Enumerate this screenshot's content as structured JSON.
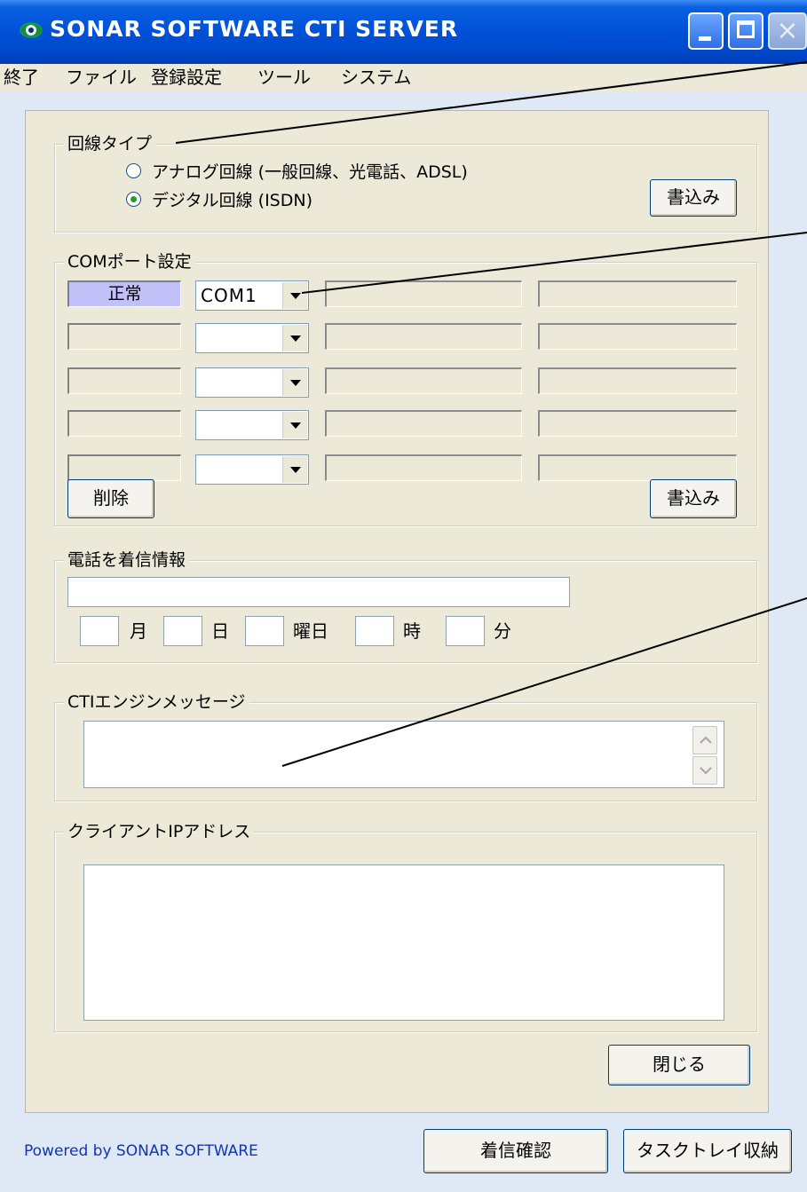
{
  "window": {
    "title": "SONAR SOFTWARE CTI SERVER",
    "close_glyph": "×",
    "icon": "app-eye-icon"
  },
  "menu": [
    {
      "label": "終了"
    },
    {
      "label": "ファイル"
    },
    {
      "label": "登録設定"
    },
    {
      "label": "ツール"
    },
    {
      "label": "システム"
    }
  ],
  "line_type": {
    "group_label": "回線タイプ",
    "options": [
      {
        "label": "アナログ回線 (一般回線、光電話、ADSL)",
        "checked": false
      },
      {
        "label": "デジタル回線 (ISDN)",
        "checked": true
      }
    ],
    "write_button": "書込み"
  },
  "com_ports": {
    "group_label": "COMポート設定",
    "rows": [
      {
        "status": "正常",
        "active": true,
        "port": "COM1"
      },
      {
        "status": "",
        "active": false,
        "port": ""
      },
      {
        "status": "",
        "active": false,
        "port": ""
      },
      {
        "status": "",
        "active": false,
        "port": ""
      },
      {
        "status": "",
        "active": false,
        "port": ""
      }
    ],
    "delete_button": "削除",
    "write_button": "書込み",
    "status_active_color": "#c1c0f7"
  },
  "incoming": {
    "group_label": "電話を着信情報",
    "caller_value": "",
    "month_label": "月",
    "day_label": "日",
    "weekday_label": "曜日",
    "hour_label": "時",
    "minute_label": "分"
  },
  "engine": {
    "group_label": "CTIエンジンメッセージ",
    "message": ""
  },
  "clients": {
    "group_label": "クライアントIPアドレス",
    "list": ""
  },
  "buttons": {
    "close": "閉じる",
    "check_incoming": "着信確認",
    "tray": "タスクトレイ収納"
  },
  "footer": {
    "powered_by": "Powered by SONAR SOFTWARE"
  },
  "colors": {
    "titlebar": "#0051d8",
    "dialog": "#ece9d8",
    "client_bg": "#dfe8f5",
    "link": "#1033b8"
  }
}
